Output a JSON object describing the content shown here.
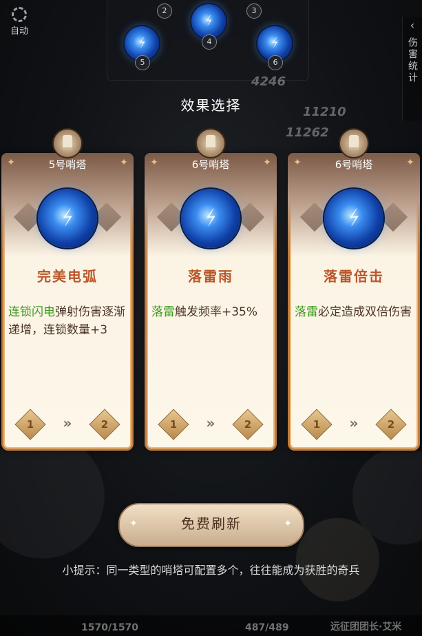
{
  "hud": {
    "auto_label": "自动",
    "side_stat_label": "伤害统计",
    "damage_numbers": [
      "4246",
      "11210",
      "11262"
    ]
  },
  "skill_slots": [
    {
      "num": "2"
    },
    {
      "num": "3"
    },
    {
      "num": "4"
    },
    {
      "num": "5"
    },
    {
      "num": "6"
    }
  ],
  "title": "效果选择",
  "cards": [
    {
      "tower": "5号哨塔",
      "name": "完美电弧",
      "desc_highlight": "连锁闪电",
      "desc_rest": "弹射伤害逐渐递增，连锁数量+3",
      "level_from": "1",
      "level_to": "2"
    },
    {
      "tower": "6号哨塔",
      "name": "落雷雨",
      "desc_highlight": "落雷",
      "desc_rest": "触发频率+35%",
      "level_from": "1",
      "level_to": "2"
    },
    {
      "tower": "6号哨塔",
      "name": "落雷倍击",
      "desc_highlight": "落雷",
      "desc_rest": "必定造成双倍伤害",
      "level_from": "1",
      "level_to": "2"
    }
  ],
  "refresh_label": "免费刷新",
  "tip": "小提示：同一类型的哨塔可配置多个，往往能成为获胜的奇兵",
  "bottom": {
    "hp_left": "1570/1570",
    "hp_right": "487/489",
    "name_right": "远征团团长·艾米"
  },
  "colors": {
    "highlight_green": "#3c9a1f",
    "card_name": "#b9572a",
    "card_border": "#c07a3e"
  }
}
